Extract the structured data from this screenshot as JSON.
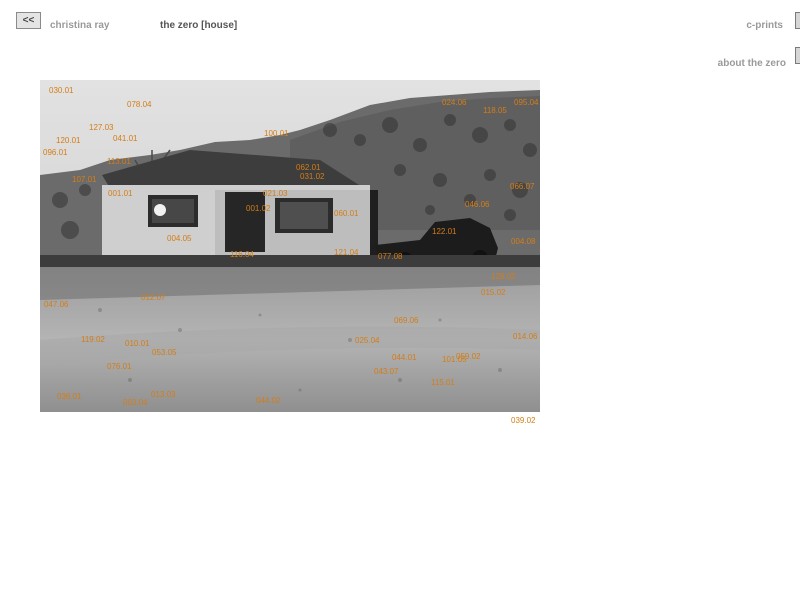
{
  "header": {
    "back_label": "<<",
    "artist": "christina ray",
    "title": "the zero [house]",
    "prints_link": "c-prints",
    "about_link": "about the zero"
  },
  "photo": {
    "description_icon": "house-photo"
  },
  "hotspots": [
    {
      "code": "030.01"
    },
    {
      "code": "078.04"
    },
    {
      "code": "127.03"
    },
    {
      "code": "041.01"
    },
    {
      "code": "120.01"
    },
    {
      "code": "096.01"
    },
    {
      "code": "113.01"
    },
    {
      "code": "107.01"
    },
    {
      "code": "001.01"
    },
    {
      "code": "100.01"
    },
    {
      "code": "024.06"
    },
    {
      "code": "118.05"
    },
    {
      "code": "095.04"
    },
    {
      "code": "062.01"
    },
    {
      "code": "031.02"
    },
    {
      "code": "021.03"
    },
    {
      "code": "001.02"
    },
    {
      "code": "060.01"
    },
    {
      "code": "004.05"
    },
    {
      "code": "116.04"
    },
    {
      "code": "046.06"
    },
    {
      "code": "066.07"
    },
    {
      "code": "122.01"
    },
    {
      "code": "004.08"
    },
    {
      "code": "121.04"
    },
    {
      "code": "077.08"
    },
    {
      "code": "129.02"
    },
    {
      "code": "015.02"
    },
    {
      "code": "047.06"
    },
    {
      "code": "012.07"
    },
    {
      "code": "069.06"
    },
    {
      "code": "119.02"
    },
    {
      "code": "010.01"
    },
    {
      "code": "053.05"
    },
    {
      "code": "025.04"
    },
    {
      "code": "014.06"
    },
    {
      "code": "076.01"
    },
    {
      "code": "044.01"
    },
    {
      "code": "101.05"
    },
    {
      "code": "059.02"
    },
    {
      "code": "043.07"
    },
    {
      "code": "115.01"
    },
    {
      "code": "036.01"
    },
    {
      "code": "003.04"
    },
    {
      "code": "013.03"
    },
    {
      "code": "044.02"
    },
    {
      "code": "039.02"
    }
  ]
}
